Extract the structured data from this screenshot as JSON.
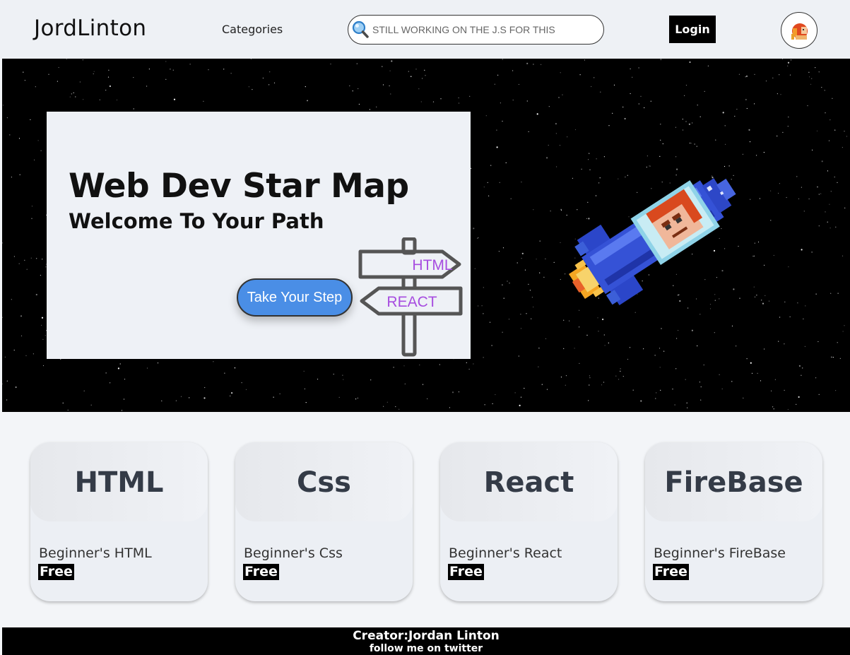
{
  "navbar": {
    "brand": "JordLinton",
    "categories_label": "Categories",
    "search_placeholder": "STILL WORKING ON THE J.S FOR THIS",
    "login_label": "Login"
  },
  "hero": {
    "title": "Web Dev Star Map",
    "subtitle": "Welcome To Your Path",
    "cta_label": "Take Your Step",
    "signpost": {
      "top_sign": "HTML",
      "bottom_sign": "REACT"
    }
  },
  "cards": [
    {
      "title": "HTML",
      "description": "Beginner's HTML",
      "badge": "Free"
    },
    {
      "title": "Css",
      "description": "Beginner's Css",
      "badge": "Free"
    },
    {
      "title": "React",
      "description": "Beginner's React",
      "badge": "Free"
    },
    {
      "title": "FireBase",
      "description": "Beginner's FireBase",
      "badge": "Free"
    }
  ],
  "footer": {
    "creator": "Creator:Jordan Linton",
    "follow": "follow me on twitter"
  },
  "colors": {
    "cta": "#4a8ee6",
    "signpost_text": "#a74de0",
    "hero_background": "#000000",
    "navbar_background": "#eef1f5"
  },
  "icons": {
    "search": "magnifier-icon",
    "avatar": "astronaut-avatar-icon",
    "rocket": "pixel-rocket-illustration"
  }
}
